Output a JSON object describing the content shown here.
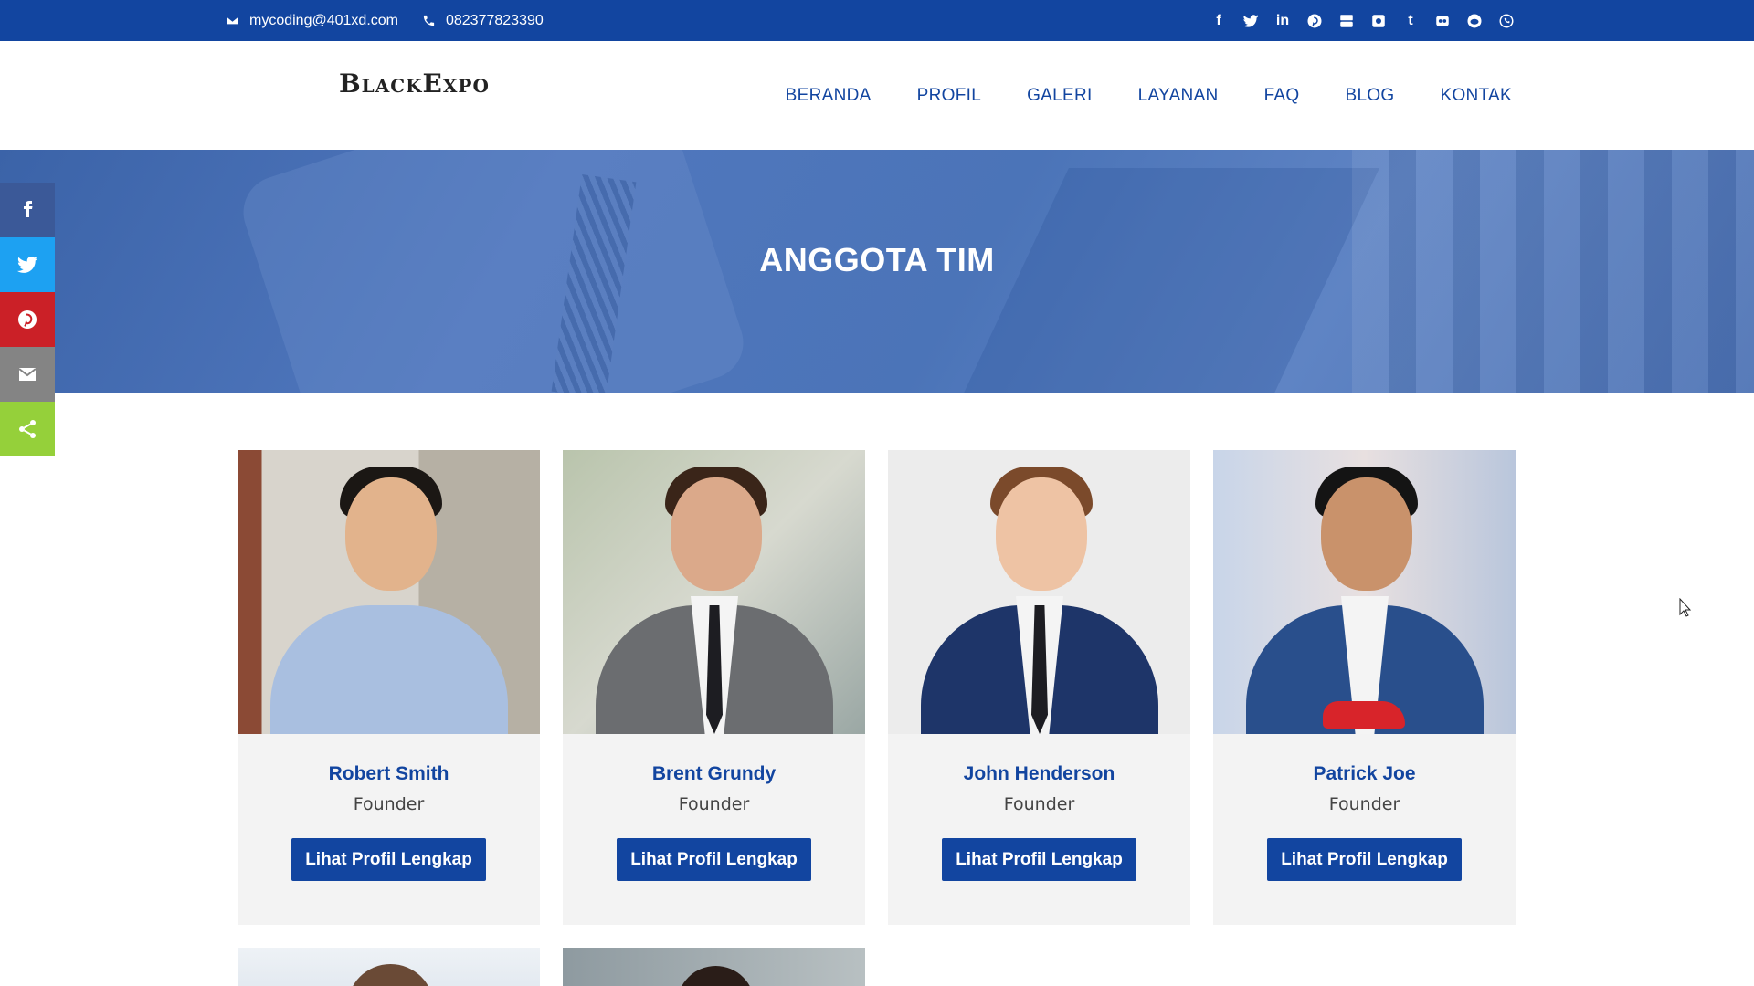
{
  "topbar": {
    "email": "mycoding@401xd.com",
    "phone": "082377823390",
    "socials": [
      "facebook-icon",
      "twitter-icon",
      "linkedin-icon",
      "pinterest-icon",
      "youtube-icon",
      "instagram-icon",
      "tumblr-icon",
      "flickr-icon",
      "reddit-icon",
      "whatsapp-icon"
    ]
  },
  "header": {
    "logo": "BlackExpo",
    "nav": [
      "BERANDA",
      "PROFIL",
      "GALERI",
      "LAYANAN",
      "FAQ",
      "BLOG",
      "KONTAK"
    ]
  },
  "banner": {
    "title": "ANGGOTA TIM"
  },
  "sharebar": {
    "items": [
      {
        "name": "facebook-icon",
        "color": "#3b5998"
      },
      {
        "name": "twitter-icon",
        "color": "#1da1f2"
      },
      {
        "name": "pinterest-icon",
        "color": "#cb2027"
      },
      {
        "name": "email-icon",
        "color": "#848484"
      },
      {
        "name": "share-icon",
        "color": "#95d03a"
      }
    ]
  },
  "team": {
    "members": [
      {
        "name": "Robert Smith",
        "role": "Founder",
        "button": "Lihat Profil Lengkap"
      },
      {
        "name": "Brent Grundy",
        "role": "Founder",
        "button": "Lihat Profil Lengkap"
      },
      {
        "name": "John Henderson",
        "role": "Founder",
        "button": "Lihat Profil Lengkap"
      },
      {
        "name": "Patrick Joe",
        "role": "Founder",
        "button": "Lihat Profil Lengkap"
      }
    ]
  },
  "colors": {
    "brand": "#1245a0",
    "card_bg": "#f3f3f3"
  }
}
